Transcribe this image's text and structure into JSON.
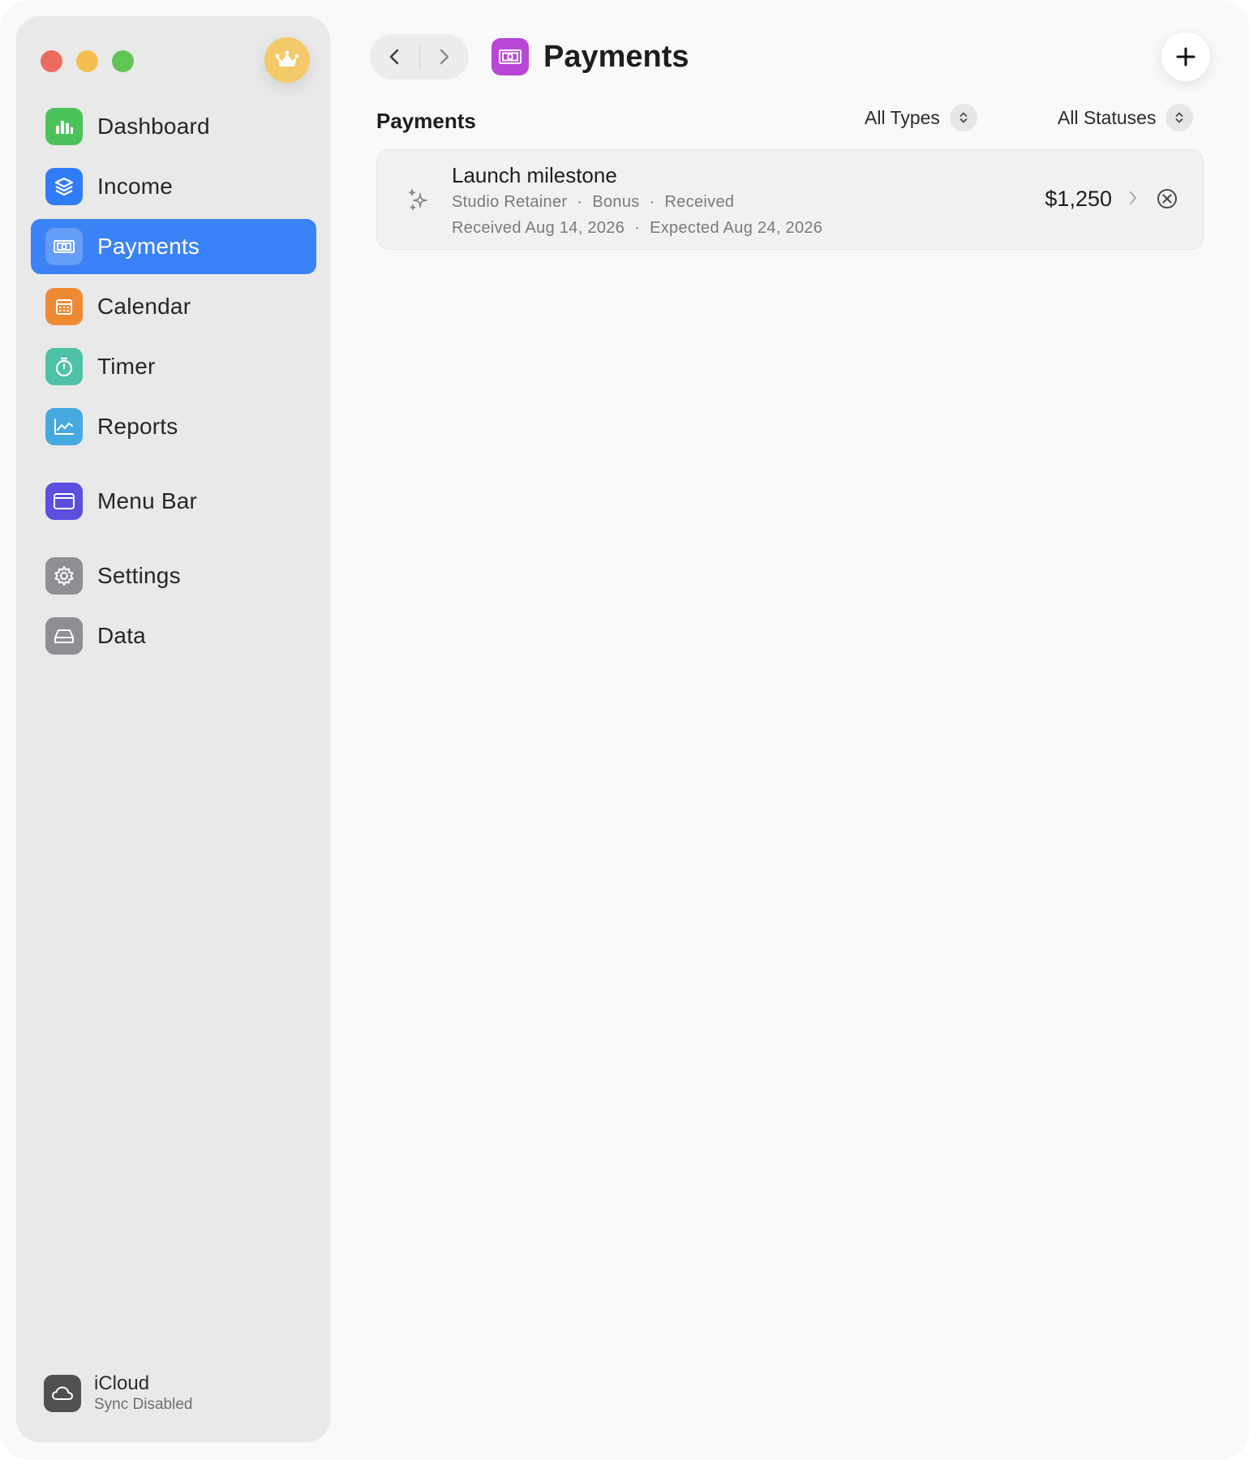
{
  "window": {
    "traffic_lights": [
      "close",
      "minimize",
      "zoom"
    ]
  },
  "sidebar": {
    "premium_icon": "crown-icon",
    "items": [
      {
        "label": "Dashboard",
        "icon": "bar-chart-icon",
        "color": "#4cc35a"
      },
      {
        "label": "Income",
        "icon": "stack-icon",
        "color": "#2f7cf6"
      },
      {
        "label": "Payments",
        "icon": "banknote-icon",
        "color": "#3b82f6",
        "active": true
      },
      {
        "label": "Calendar",
        "icon": "calendar-icon",
        "color": "#ef8a34"
      },
      {
        "label": "Timer",
        "icon": "timer-icon",
        "color": "#4dc2a8"
      },
      {
        "label": "Reports",
        "icon": "line-chart-icon",
        "color": "#46a9e0"
      },
      {
        "label": "Menu Bar",
        "icon": "window-icon",
        "color": "#5b4fe0"
      },
      {
        "label": "Settings",
        "icon": "gear-icon",
        "color": "#8e8e93"
      },
      {
        "label": "Data",
        "icon": "drive-icon",
        "color": "#8e8e93"
      }
    ],
    "icloud": {
      "title": "iCloud",
      "status": "Sync Disabled",
      "icon": "cloud-icon"
    }
  },
  "toolbar": {
    "title": "Payments",
    "title_icon_color": "#b847d6"
  },
  "section": {
    "title": "Payments",
    "filters": {
      "types": "All Types",
      "statuses": "All Statuses"
    }
  },
  "payments": [
    {
      "title": "Launch milestone",
      "client": "Studio Retainer",
      "type": "Bonus",
      "status": "Received",
      "received": "Received Aug 14, 2026",
      "expected": "Expected Aug 24, 2026",
      "amount": "$1,250",
      "icon": "sparkles-icon"
    }
  ],
  "meta_separator": "·",
  "colors": {
    "accent": "#3b82f6",
    "crown": "#f3c969"
  }
}
